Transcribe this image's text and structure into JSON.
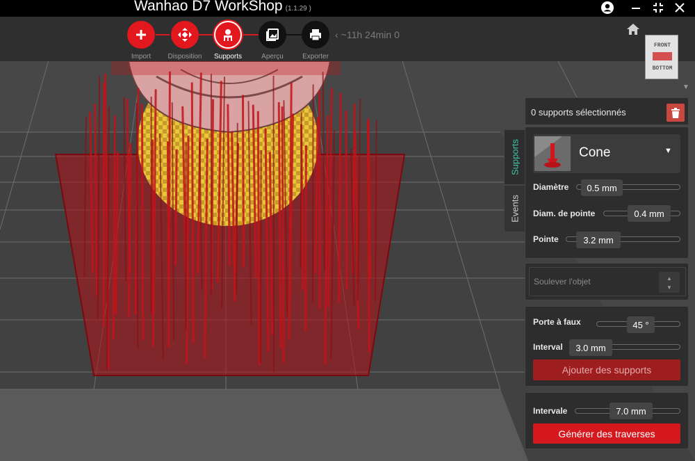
{
  "app": {
    "title": "Wanhao D7 WorkShop",
    "version": "(1.1.29 )"
  },
  "window_controls": [
    "user-icon",
    "minimize-icon",
    "exit-fullscreen-icon",
    "close-icon"
  ],
  "steps": [
    {
      "label": "Import",
      "icon": "plus-icon",
      "color": "#e3171e",
      "state": "done"
    },
    {
      "label": "Disposition",
      "icon": "move-arrows-icon",
      "color": "#e3171e",
      "state": "done"
    },
    {
      "label": "Supports",
      "icon": "supports-icon",
      "color": "#e3171e",
      "state": "active"
    },
    {
      "label": "Aperçu",
      "icon": "image-icon",
      "color": "#111111",
      "state": "pending"
    },
    {
      "label": "Exporter",
      "icon": "printer-icon",
      "color": "#111111",
      "state": "pending"
    }
  ],
  "time_estimate": "~11h 24min 0",
  "view_cube": {
    "front": "FRONT",
    "bottom": "BOTTOM"
  },
  "tabs": {
    "supports": "Supports",
    "events": "Events"
  },
  "supports_panel": {
    "selected_count": "0 supports sélectionnés",
    "support_type": "Cone",
    "diameter": {
      "label": "Diamètre",
      "value": "0.5 mm"
    },
    "tip_diameter": {
      "label": "Diam. de pointe",
      "value": "0.4 mm"
    },
    "tip": {
      "label": "Pointe",
      "value": "3.2 mm"
    }
  },
  "lift_panel": {
    "label": "Soulever l'objet"
  },
  "overhang_panel": {
    "overhang": {
      "label": "Porte à faux",
      "value": "45 °"
    },
    "interval": {
      "label": "Interval",
      "value": "3.0 mm"
    },
    "add_button": "Ajouter des supports"
  },
  "braces_panel": {
    "interval": {
      "label": "Intervale",
      "value": "7.0 mm"
    },
    "generate_button": "Générer des traverses"
  },
  "colors": {
    "accent": "#e3171e",
    "accent_dim": "#9e1e20",
    "tab_active": "#3cc6a4",
    "panel_bg": "#2d2d2d"
  }
}
